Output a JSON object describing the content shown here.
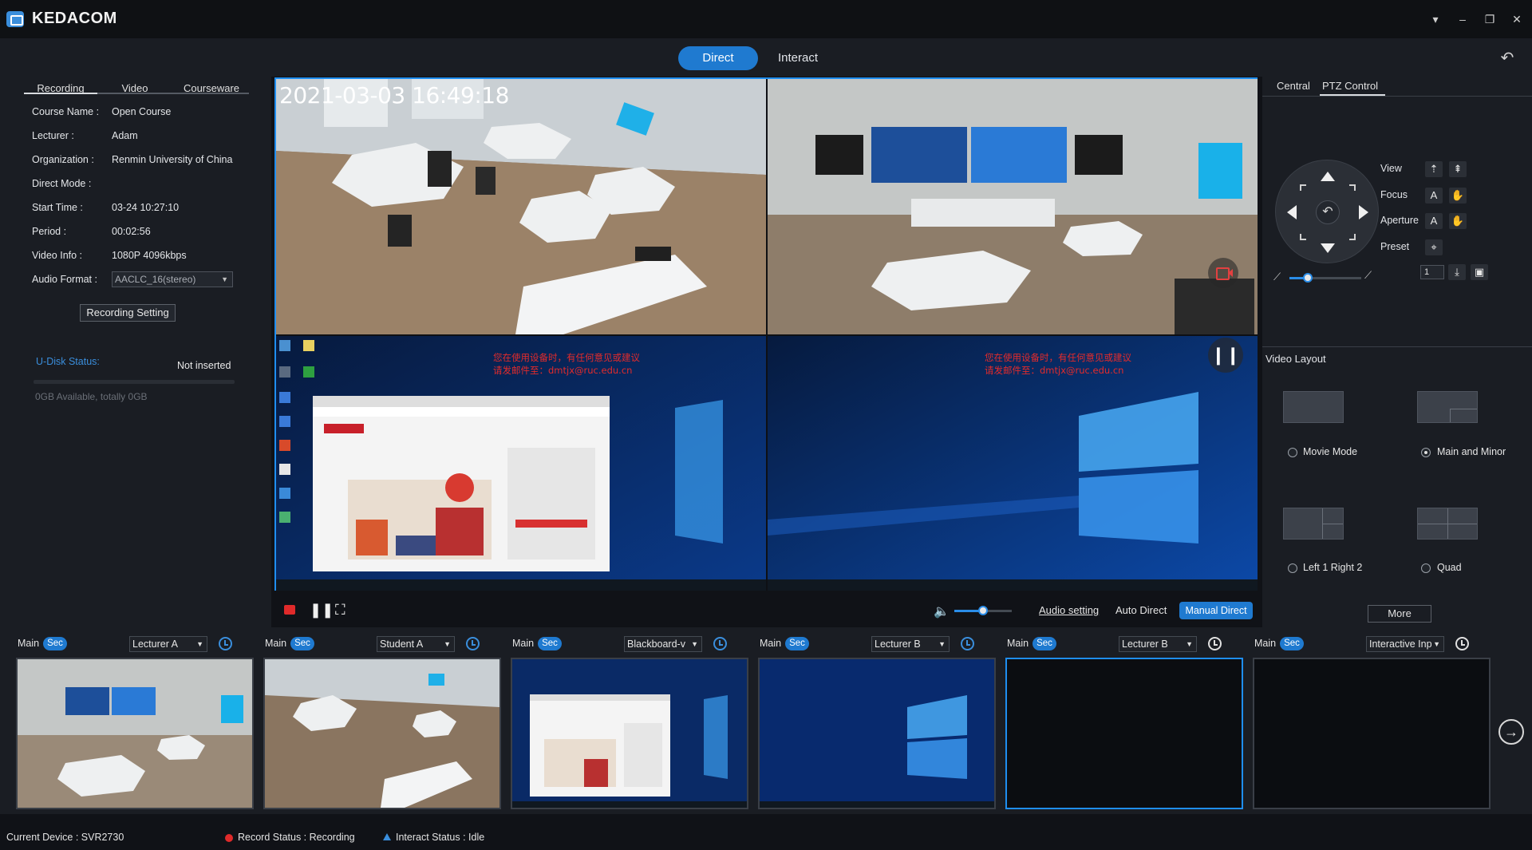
{
  "app": {
    "brand": "KEDACOM"
  },
  "window_controls": {
    "dropdown": "▾",
    "minimize": "–",
    "restore": "❐",
    "close": "✕"
  },
  "mode_tabs": {
    "direct": "Direct",
    "interact": "Interact"
  },
  "left_panel": {
    "tabs": [
      "Recording",
      "Video",
      "Courseware"
    ],
    "fields": [
      {
        "label": "Course Name :",
        "value": "Open Course"
      },
      {
        "label": "Lecturer :",
        "value": "Adam"
      },
      {
        "label": "Organization :",
        "value": "Renmin University of China"
      },
      {
        "label": "Direct Mode :",
        "value": ""
      },
      {
        "label": "Start Time :",
        "value": "03-24 10:27:10"
      },
      {
        "label": "Period :",
        "value": "00:02:56"
      },
      {
        "label": "Video Info :",
        "value": "1080P  4096kbps"
      }
    ],
    "audio_format_label": "Audio Format :",
    "audio_format_value": "AACLC_16(stereo)",
    "recording_setting_button": "Recording Setting",
    "udisk_label": "U-Disk Status:",
    "udisk_status": "Not inserted",
    "udisk_available": "0GB Available, totally 0GB"
  },
  "preview": {
    "timestamp": "2021-03-03   16:49:18",
    "notice_line1": "您在使用设备时，有任何意见或建议",
    "notice_line2": "请发邮件至：dmtjx@ruc.edu.cn",
    "pause_glyph": "❙❙"
  },
  "controls": {
    "volume_level": 0.5,
    "audio_setting": "Audio setting",
    "auto_direct": "Auto Direct",
    "manual_direct": "Manual Direct"
  },
  "right_panel": {
    "tabs": {
      "central": "Central",
      "ptz": "PTZ Control"
    },
    "ptz_labels": {
      "view": "View",
      "focus": "Focus",
      "aperture": "Aperture",
      "preset": "Preset"
    },
    "preset_number": "1",
    "zoom_level": 0.25,
    "video_layout_title": "Video Layout",
    "layouts": [
      {
        "label": "Movie Mode",
        "selected": false
      },
      {
        "label": "Main and Minor",
        "selected": true
      },
      {
        "label": "Left 1 Right 2",
        "selected": false
      },
      {
        "label": "Quad",
        "selected": false
      }
    ],
    "more_button": "More"
  },
  "sources": [
    {
      "main": "Main",
      "sec": "Sec",
      "selected": "Lecturer A"
    },
    {
      "main": "Main",
      "sec": "Sec",
      "selected": "Student A"
    },
    {
      "main": "Main",
      "sec": "Sec",
      "selected": "Blackboard-v"
    },
    {
      "main": "Main",
      "sec": "Sec",
      "selected": "Lecturer B"
    },
    {
      "main": "Main",
      "sec": "Sec",
      "selected": "Lecturer B"
    },
    {
      "main": "Main",
      "sec": "Sec",
      "selected": "Interactive Inp"
    }
  ],
  "status_bar": {
    "device": "Current Device : SVR2730",
    "record_status": "Record Status : Recording",
    "interact_status": "Interact Status : Idle"
  },
  "colors": {
    "accent": "#1f7ad0",
    "active_border": "#1f8ef0",
    "record_red": "#e02a2a"
  }
}
